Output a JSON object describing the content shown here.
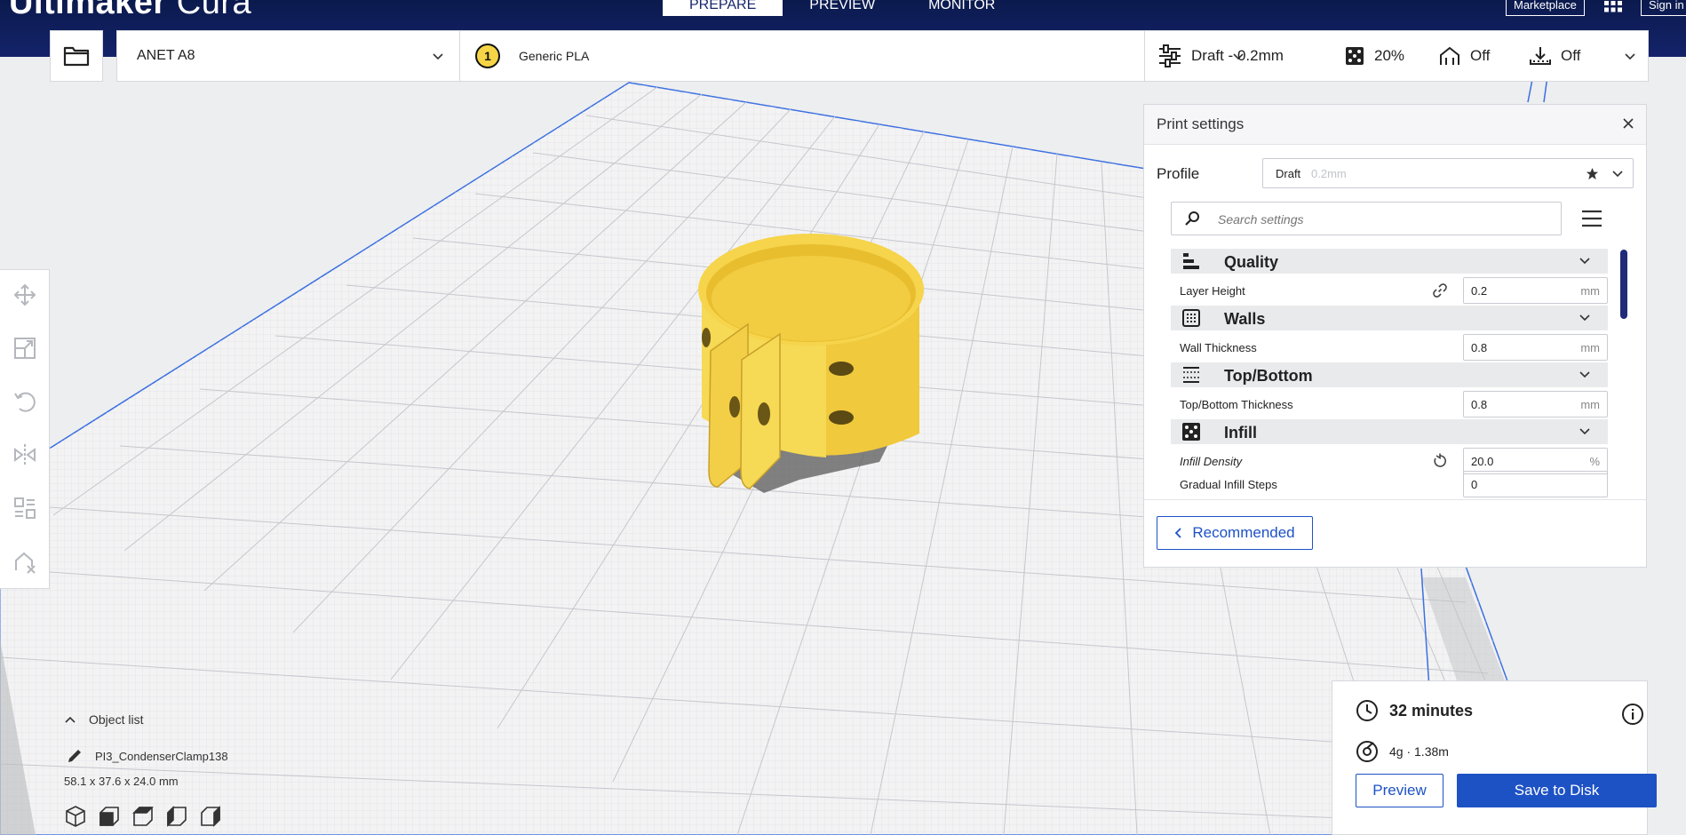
{
  "app": {
    "brand_bold": "Ultimaker",
    "brand_light": "Cura"
  },
  "stages": [
    {
      "label": "PREPARE",
      "active": true
    },
    {
      "label": "PREVIEW",
      "active": false
    },
    {
      "label": "MONITOR",
      "active": false
    }
  ],
  "header": {
    "marketplace": "Marketplace",
    "signin": "Sign in"
  },
  "toolbar": {
    "printer": "ANET A8",
    "extruder_number": "1",
    "material": "Generic PLA",
    "profile_summary": "Draft - 0.2mm",
    "infill": "20%",
    "support": "Off",
    "adhesion": "Off"
  },
  "print_settings": {
    "title": "Print settings",
    "profile_label": "Profile",
    "profile_name": "Draft",
    "profile_layer": "0.2mm",
    "search_placeholder": "Search settings",
    "categories": [
      {
        "label": "Quality",
        "settings": [
          {
            "label": "Layer Height",
            "value": "0.2",
            "unit": "mm",
            "italic": false,
            "extra": "link"
          }
        ]
      },
      {
        "label": "Walls",
        "settings": [
          {
            "label": "Wall Thickness",
            "value": "0.8",
            "unit": "mm",
            "italic": false,
            "extra": ""
          }
        ]
      },
      {
        "label": "Top/Bottom",
        "settings": [
          {
            "label": "Top/Bottom Thickness",
            "value": "0.8",
            "unit": "mm",
            "italic": false,
            "extra": ""
          }
        ]
      },
      {
        "label": "Infill",
        "settings": [
          {
            "label": "Infill Density",
            "value": "20.0",
            "unit": "%",
            "italic": true,
            "extra": "reset"
          },
          {
            "label": "Gradual Infill Steps",
            "value": "0",
            "unit": "",
            "italic": false,
            "extra": ""
          }
        ]
      }
    ],
    "recommended_label": "Recommended"
  },
  "object_list": {
    "toggle_label": "Object list",
    "object_name": "PI3_CondenserClamp138",
    "dimensions": "58.1 x 37.6 x 24.0 mm"
  },
  "action_panel": {
    "print_time": "32 minutes",
    "material_usage": "4g · 1.38m",
    "preview_label": "Preview",
    "save_label": "Save to Disk"
  },
  "colors": {
    "header": "#14236a",
    "accent": "#1d52c5",
    "model": "#f5d547",
    "build_plate": "#f3f3f3"
  }
}
